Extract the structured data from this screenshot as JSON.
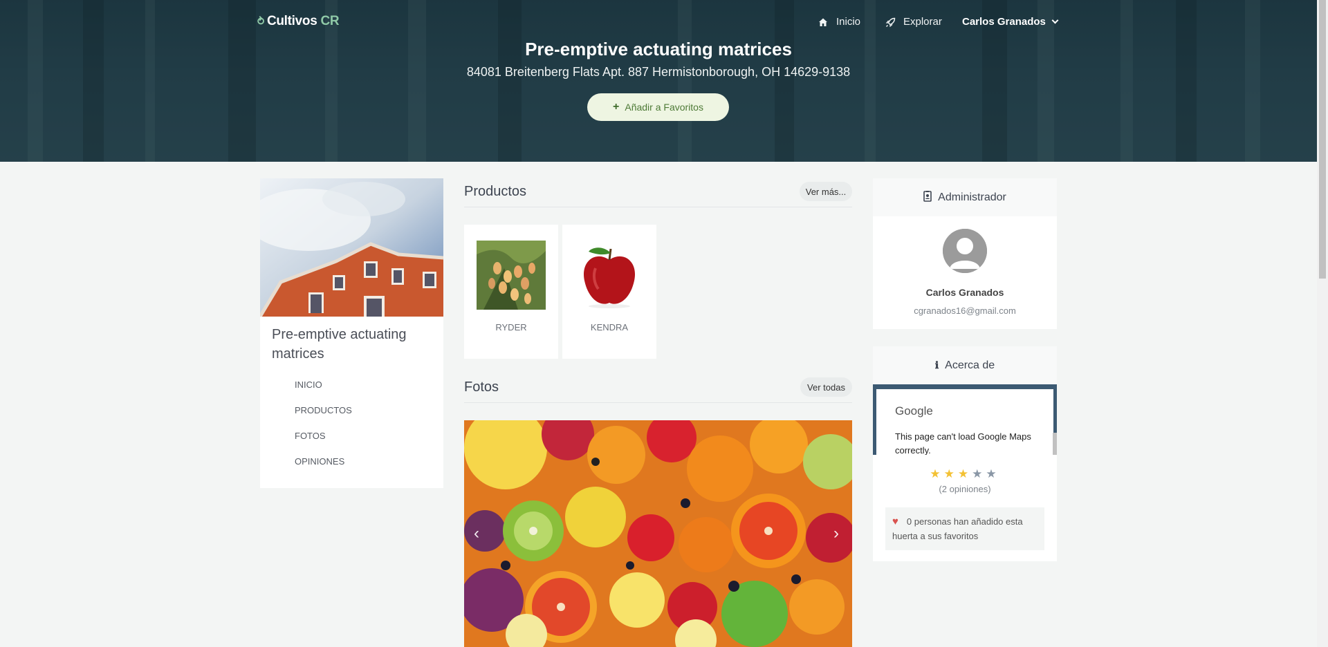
{
  "brand": {
    "name": "Cultivos",
    "suffix": "CR"
  },
  "nav": {
    "home": "Inicio",
    "explore": "Explorar",
    "user": "Carlos Granados"
  },
  "hero": {
    "title": "Pre-emptive actuating matrices",
    "address": "84081 Breitenberg Flats Apt. 887 Hermistonborough, OH 14629-9138",
    "favorite_button": "Añadir a Favoritos"
  },
  "sidebar": {
    "name": "Pre-emptive actuating matrices",
    "menu": [
      "INICIO",
      "PRODUCTOS",
      "FOTOS",
      "OPINIONES"
    ]
  },
  "products": {
    "title": "Productos",
    "more": "Ver más...",
    "items": [
      {
        "label": "RYDER",
        "icon": "mango-tree-image"
      },
      {
        "label": "KENDRA",
        "icon": "red-apple-image"
      }
    ]
  },
  "photos": {
    "title": "Fotos",
    "all": "Ver todas",
    "prev": "‹",
    "next": "›"
  },
  "admin": {
    "header": "Administrador",
    "name": "Carlos Granados",
    "email": "cgranados16@gmail.com"
  },
  "about": {
    "header": "Acerca de",
    "map_brand": "Google",
    "map_error": "This page can't load Google Maps correctly.",
    "rating": 3,
    "rating_max": 5,
    "reviews": "(2 opiniones)",
    "favorites_text": "0 personas han añadido esta huerta a sus favoritos"
  },
  "colors": {
    "hero": "#27444f",
    "accent": "#8fc9a7",
    "fav_button_bg": "#eef5e2",
    "star": "#f3c134"
  }
}
